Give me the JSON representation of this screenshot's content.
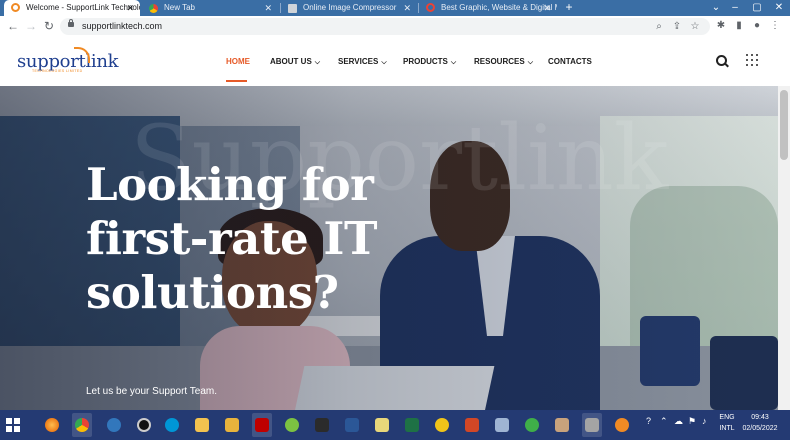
{
  "browser": {
    "tabs": [
      {
        "title": "Welcome - SupportLink Technolo",
        "icon": "supportlink-favicon",
        "icon_color": "#f08a24"
      },
      {
        "title": "New Tab",
        "icon": "chrome-icon",
        "icon_color": "#34a853"
      },
      {
        "title": "Online Image Compressor",
        "icon": "image-icon",
        "icon_color": "#bdc1c6"
      },
      {
        "title": "Best Graphic, Website & Digital M",
        "icon": "opera-icon",
        "icon_color": "#ea4335"
      }
    ],
    "active_tab": 0,
    "url": "supportlinktech.com"
  },
  "site": {
    "logo_text": "supportlink",
    "logo_subtitle": "TECHNOLOGIES LIMITED",
    "nav": [
      {
        "label": "HOME",
        "active": true,
        "dropdown": false
      },
      {
        "label": "ABOUT US",
        "active": false,
        "dropdown": true
      },
      {
        "label": "SERVICES",
        "active": false,
        "dropdown": true
      },
      {
        "label": "PRODUCTS",
        "active": false,
        "dropdown": true
      },
      {
        "label": "RESOURCES",
        "active": false,
        "dropdown": true
      },
      {
        "label": "CONTACTS",
        "active": false,
        "dropdown": false
      }
    ],
    "hero": {
      "watermark": "Supportlink",
      "headline": "Looking for first-rate IT solutions?",
      "tagline": "Let us be your Support Team."
    }
  },
  "taskbar": {
    "apps": [
      "firefox-icon",
      "chrome-icon",
      "edge-icon",
      "webcam-icon",
      "hp-icon",
      "file-explorer-icon",
      "folder-icon",
      "filezilla-icon",
      "green-app-icon",
      "terminal-icon",
      "word-icon",
      "outlook-icon",
      "excel-icon",
      "notes-icon",
      "powerpoint-icon",
      "checkmark-app-icon",
      "paint-icon",
      "settings-icon"
    ],
    "language": "ENG",
    "language_sub": "INTL",
    "time": "09:43",
    "date": "02/05/2022"
  },
  "colors": {
    "accent": "#e65a28",
    "brand_blue": "#1f3f8f",
    "tabbar": "#3a6ea5",
    "taskbar": "#243a73"
  }
}
